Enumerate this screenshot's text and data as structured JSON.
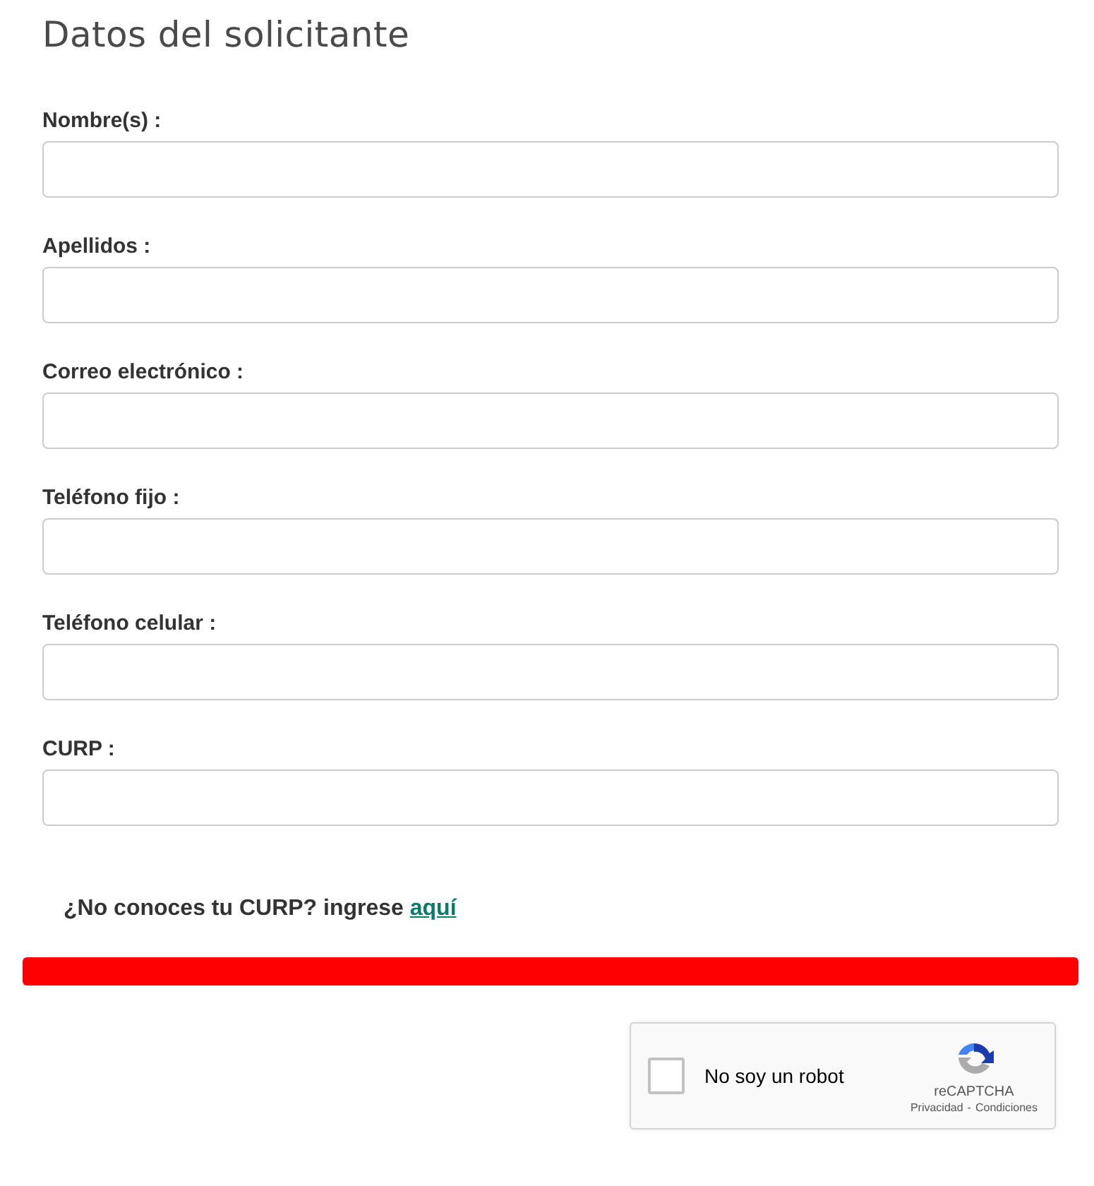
{
  "title": "Datos del solicitante",
  "fields": [
    {
      "label": "Nombre(s) :"
    },
    {
      "label": "Apellidos :"
    },
    {
      "label": "Correo electrónico :"
    },
    {
      "label": "Teléfono fijo :"
    },
    {
      "label": "Teléfono celular :"
    },
    {
      "label": "CURP :"
    }
  ],
  "curp_hint": {
    "text": "¿No conoces tu CURP? ingrese",
    "link": "aquí"
  },
  "captcha": {
    "label": "No soy un robot",
    "checked": false,
    "brand": "reCAPTCHA",
    "links": [
      "Privacidad",
      "Condiciones"
    ],
    "separator": "-"
  }
}
